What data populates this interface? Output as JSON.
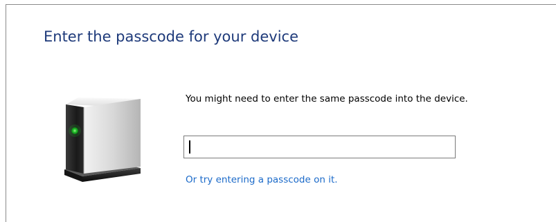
{
  "dialog": {
    "title": "Enter the passcode for your device",
    "instruction": "You might need to enter the same passcode into the device.",
    "passcode_value": "",
    "alt_link": "Or try entering a passcode on it."
  },
  "colors": {
    "title": "#1e3a7a",
    "link": "#1b6ac9",
    "device_led": "#22c02a"
  },
  "icons": {
    "device": "device-icon"
  }
}
